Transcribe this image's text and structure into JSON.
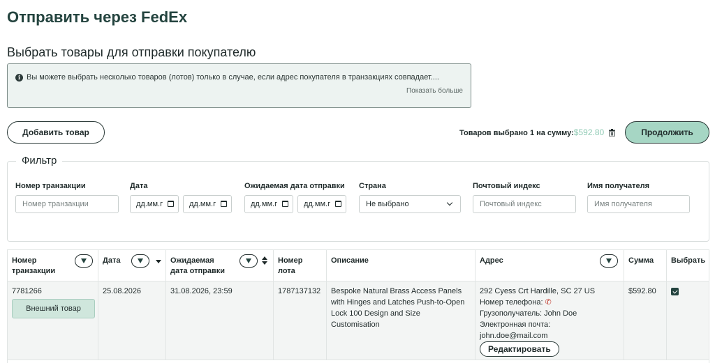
{
  "page": {
    "title": "Отправить через FedEx",
    "section_title": "Выбрать товары для отправки покупателю"
  },
  "info": {
    "text": "Вы можете выбрать несколько товаров (лотов) только в случае, если адрес покупателя в транзакциях совпадает....",
    "show_more": "Показать больше"
  },
  "toolbar": {
    "add_label": "Добавить товар",
    "selected_text": "Товаров выбрано 1 на сумму:",
    "selected_amount": "$592.80",
    "continue_label": "Продолжить"
  },
  "filter": {
    "legend": "Фильтр",
    "transaction_label": "Номер транзакции",
    "transaction_placeholder": "Номер транзакции",
    "date_label": "Дата",
    "date_from": "дд.мм.г",
    "date_to": "дд.мм.г",
    "ship_label": "Ожидаемая дата отправки",
    "ship_from": "дд.мм.г",
    "ship_to": "дд.мм.г",
    "country_label": "Страна",
    "country_value": "Не выбрано",
    "zip_label": "Почтовый индекс",
    "zip_placeholder": "Почтовый индекс",
    "recipient_label": "Имя получателя",
    "recipient_placeholder": "Имя получателя"
  },
  "table": {
    "headers": {
      "transaction_line1": "Номер",
      "transaction_line2": "транзакции",
      "date": "Дата",
      "ship_line1": "Ожидаемая",
      "ship_line2": "дата отправки",
      "lot": "Номер лота",
      "description": "Описание",
      "address": "Адрес",
      "amount": "Сумма",
      "select": "Выбрать"
    },
    "row": {
      "transaction": "7781266",
      "external_label": "Внешний товар",
      "date": "25.08.2026",
      "ship_date": "31.08.2026, 23:59",
      "lot": "1787137132",
      "description": "Bespoke Natural Brass Access Panels with Hinges and Latches Push-to-Open Lock 100 Design and Size Customisation",
      "address_line": "292 Cyess Crt Hardille, SC 27 US",
      "phone_label": "Номер телефона:",
      "consignee": "Грузополучатель: John Doe",
      "email_label": "Электронная почта:",
      "email": "john.doe@mail.com",
      "edit_label": "Редактировать",
      "amount": "$592.80",
      "selected": true
    }
  }
}
